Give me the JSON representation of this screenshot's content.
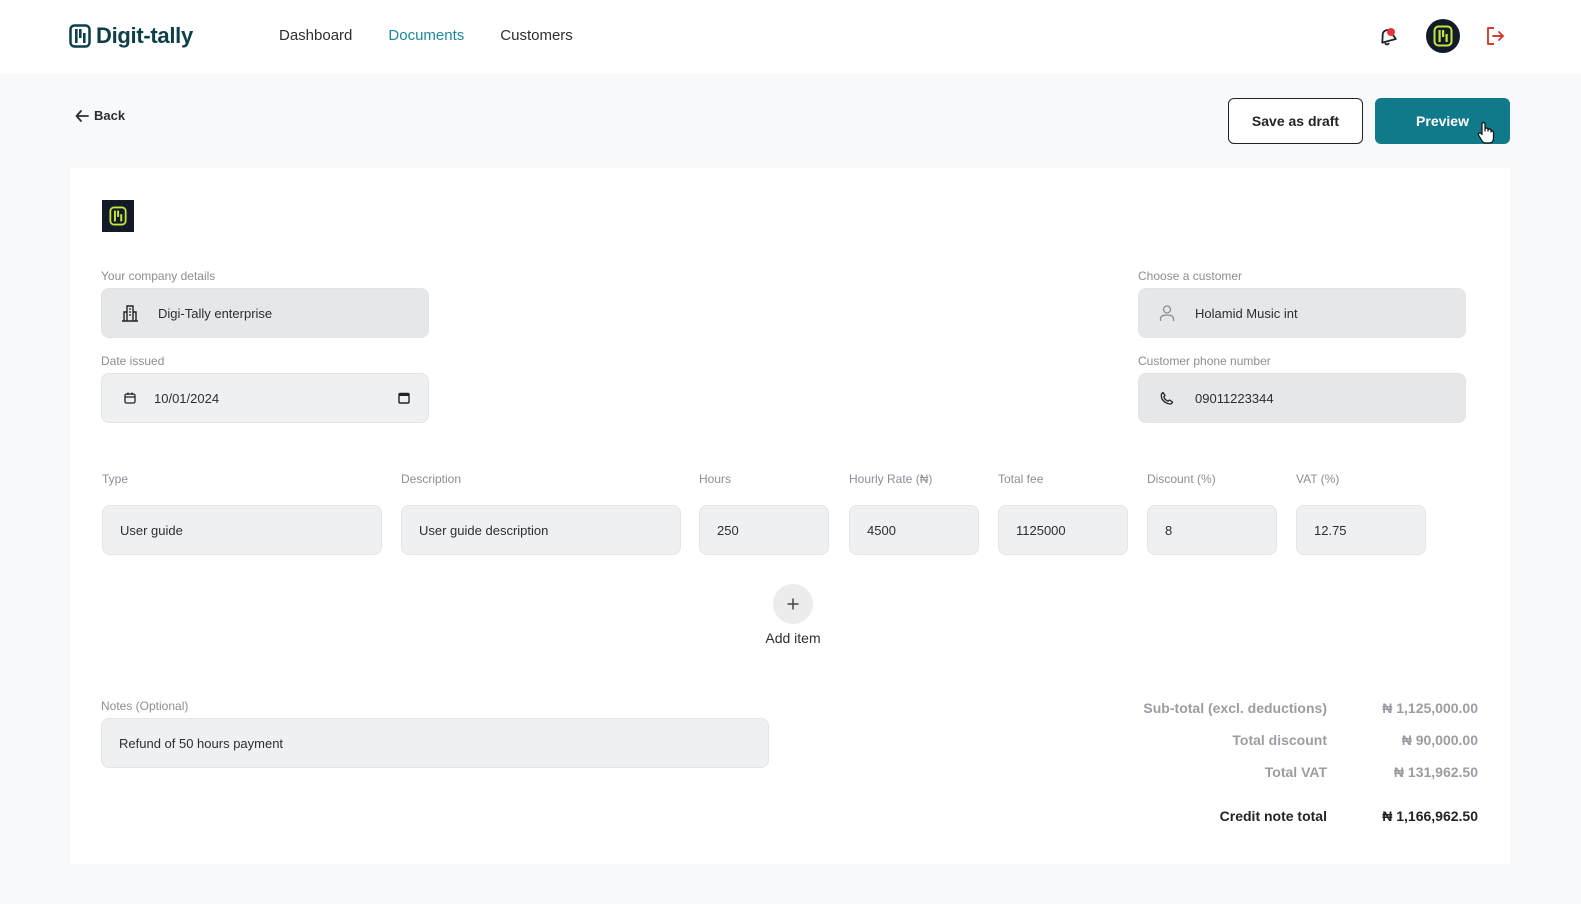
{
  "app": {
    "name": "Digit-tally",
    "brand_color": "#117a8a",
    "accent_lime": "#c6e63a"
  },
  "nav": {
    "items": [
      {
        "label": "Dashboard",
        "active": false
      },
      {
        "label": "Documents",
        "active": true
      },
      {
        "label": "Customers",
        "active": false
      }
    ]
  },
  "header_icons": {
    "notification": "bell-icon",
    "avatar": "avatar-logo",
    "logout": "logout-icon"
  },
  "toolbar": {
    "back_label": "Back",
    "save_draft_label": "Save as draft",
    "preview_label": "Preview"
  },
  "form": {
    "company": {
      "label": "Your company details",
      "value": "Digi-Tally enterprise",
      "icon": "building-icon"
    },
    "date": {
      "label": "Date issued",
      "value": "10/01/2024",
      "icon": "calendar-icon"
    },
    "customer": {
      "label": "Choose a customer",
      "value": "Holamid Music int",
      "icon": "user-icon"
    },
    "phone": {
      "label": "Customer phone number",
      "value": "09011223344",
      "icon": "phone-icon"
    }
  },
  "items_table": {
    "columns": [
      "Type",
      "Description",
      "Hours",
      "Hourly Rate (₦)",
      "Total fee",
      "Discount (%)",
      "VAT (%)"
    ],
    "rows": [
      {
        "type": "User guide",
        "description": "User guide description",
        "hours": "250",
        "hourly_rate": "4500",
        "total_fee": "1125000",
        "discount": "8",
        "vat": "12.75"
      }
    ],
    "add_item_label": "Add item"
  },
  "notes": {
    "label": "Notes (Optional)",
    "value": "Refund of 50 hours payment"
  },
  "summary": {
    "subtotal_label": "Sub-total (excl. deductions)",
    "subtotal_value": "₦ 1,125,000.00",
    "discount_label": "Total discount",
    "discount_value": "₦ 90,000.00",
    "vat_label": "Total VAT",
    "vat_value": "₦ 131,962.50",
    "total_label": "Credit note total",
    "total_value": "₦ 1,166,962.50"
  }
}
